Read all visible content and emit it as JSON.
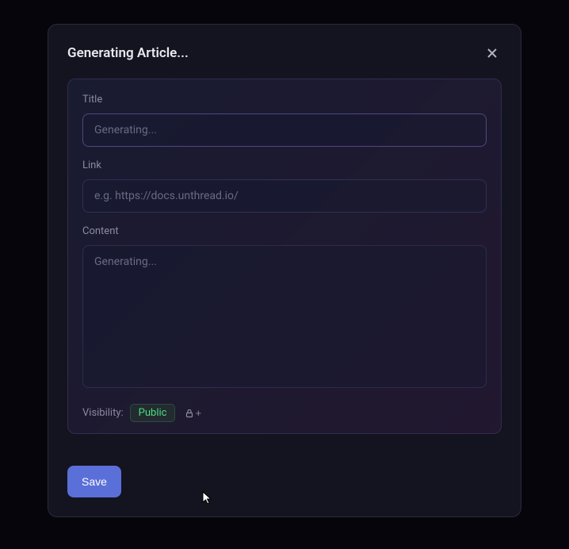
{
  "modal": {
    "title": "Generating Article...",
    "fields": {
      "title": {
        "label": "Title",
        "placeholder": "Generating...",
        "value": ""
      },
      "link": {
        "label": "Link",
        "placeholder": "e.g. https://docs.unthread.io/",
        "value": ""
      },
      "content": {
        "label": "Content",
        "placeholder": "Generating...",
        "value": ""
      }
    },
    "visibility": {
      "label": "Visibility:",
      "badge": "Public",
      "addLabel": "+"
    },
    "saveLabel": "Save"
  }
}
